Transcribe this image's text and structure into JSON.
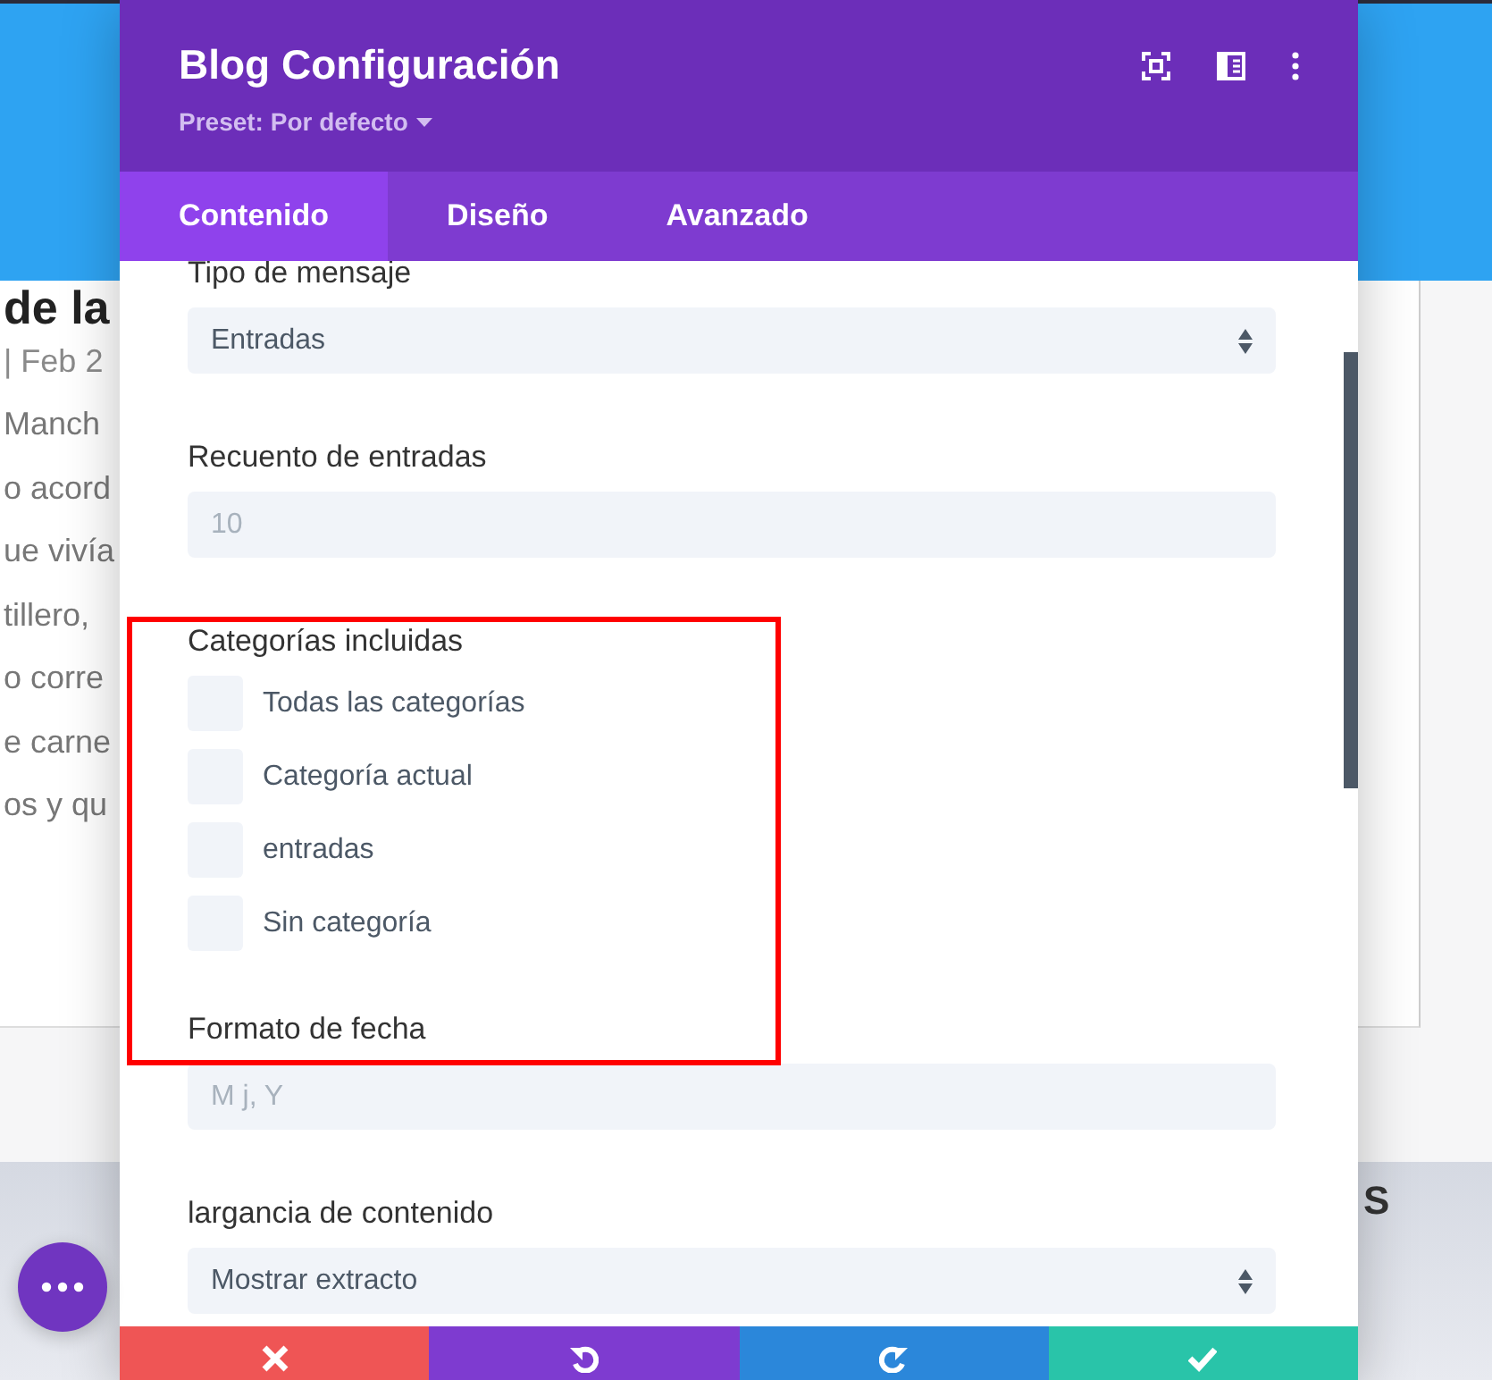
{
  "background_page": {
    "heading": "de la",
    "meta": "| Feb 2",
    "lines": [
      "Manch",
      "o acord",
      "ue vivía",
      "tillero,",
      "o corre",
      "e carne",
      "os y qu"
    ],
    "side_text": "S"
  },
  "modal": {
    "title": "Blog Configuración",
    "preset": "Preset: Por defecto",
    "header_icons": [
      {
        "kind": "focus"
      },
      {
        "kind": "sidebar"
      },
      {
        "kind": "more"
      }
    ],
    "tabs": [
      {
        "label": "Contenido",
        "selected": true
      },
      {
        "label": "Diseño",
        "selected": false
      },
      {
        "label": "Avanzado",
        "selected": false
      }
    ],
    "fields": [
      {
        "kind": "select",
        "label": "Tipo de mensaje",
        "value": "Entradas"
      },
      {
        "kind": "input",
        "label": "Recuento de entradas",
        "placeholder": "10"
      },
      {
        "kind": "checkboxes",
        "label": "Categorías incluidas",
        "options": [
          {
            "label": "Todas las categorías",
            "checked": false
          },
          {
            "label": "Categoría actual",
            "checked": false
          },
          {
            "label": "entradas",
            "checked": false
          },
          {
            "label": "Sin categoría",
            "checked": false
          }
        ]
      },
      {
        "kind": "input",
        "label": "Formato de fecha",
        "placeholder": "M j, Y"
      },
      {
        "kind": "select",
        "label": "largancia de contenido",
        "value": "Mostrar extracto"
      }
    ],
    "footer_buttons": [
      {
        "kind": "discard"
      },
      {
        "kind": "undo"
      },
      {
        "kind": "redo"
      },
      {
        "kind": "save"
      }
    ]
  },
  "floating_button": {
    "kind": "more"
  },
  "annotations": [
    {
      "kind": "rectangle"
    }
  ]
}
